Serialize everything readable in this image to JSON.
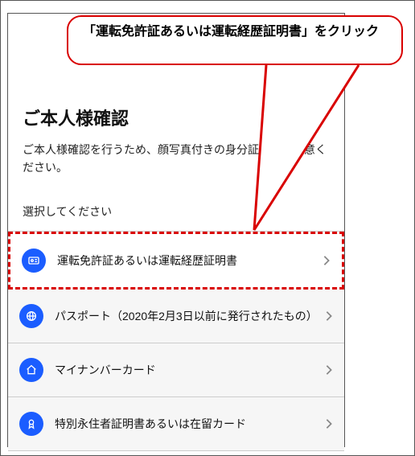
{
  "callout": {
    "text": "「運転免許証あるいは運転経歴証明書」をクリック"
  },
  "page": {
    "title": "ご本人様確認",
    "description": "ご本人様確認を行うため、顔写真付きの身分証書をご用意ください。",
    "select_prompt": "選択してください",
    "options": [
      {
        "label": "運転免許証あるいは運転経歴証明書",
        "icon": "id-card-icon"
      },
      {
        "label": "パスポート（2020年2月3日以前に発行されたもの）",
        "icon": "globe-icon"
      },
      {
        "label": "マイナンバーカード",
        "icon": "home-icon"
      },
      {
        "label": "特別永住者証明書あるいは在留カード",
        "icon": "badge-icon"
      }
    ]
  },
  "colors": {
    "accent_blue": "#1b5dff",
    "callout_red": "#d90000"
  }
}
